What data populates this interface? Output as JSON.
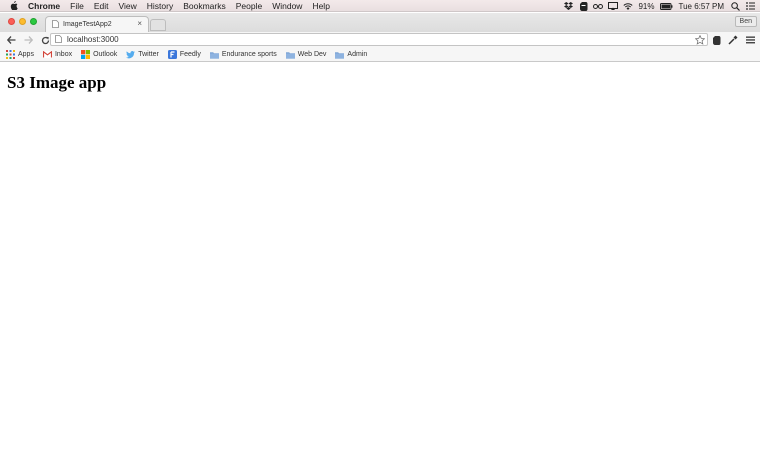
{
  "menubar": {
    "app_name": "Chrome",
    "items": [
      "File",
      "Edit",
      "View",
      "History",
      "Bookmarks",
      "People",
      "Window",
      "Help"
    ],
    "battery": "91%",
    "clock": "Tue 6:57 PM"
  },
  "browser": {
    "tab_title": "ImageTestApp2",
    "tab_close": "×",
    "profile_name": "Ben",
    "url": "localhost:3000"
  },
  "bookmarks": [
    {
      "label": "Apps",
      "icon": "apps-grid-icon"
    },
    {
      "label": "Inbox",
      "icon": "gmail-icon"
    },
    {
      "label": "Outlook",
      "icon": "outlook-icon"
    },
    {
      "label": "Twitter",
      "icon": "twitter-icon"
    },
    {
      "label": "Feedly",
      "icon": "feedly-icon"
    },
    {
      "label": "Endurance sports",
      "icon": "folder-icon"
    },
    {
      "label": "Web Dev",
      "icon": "folder-icon"
    },
    {
      "label": "Admin",
      "icon": "folder-icon"
    }
  ],
  "page": {
    "heading": "S3 Image app"
  },
  "colors": {
    "close": "#fc5f57",
    "minimize": "#fdbc2e",
    "zoom": "#2ac940",
    "folder": "#7fa6d6"
  }
}
